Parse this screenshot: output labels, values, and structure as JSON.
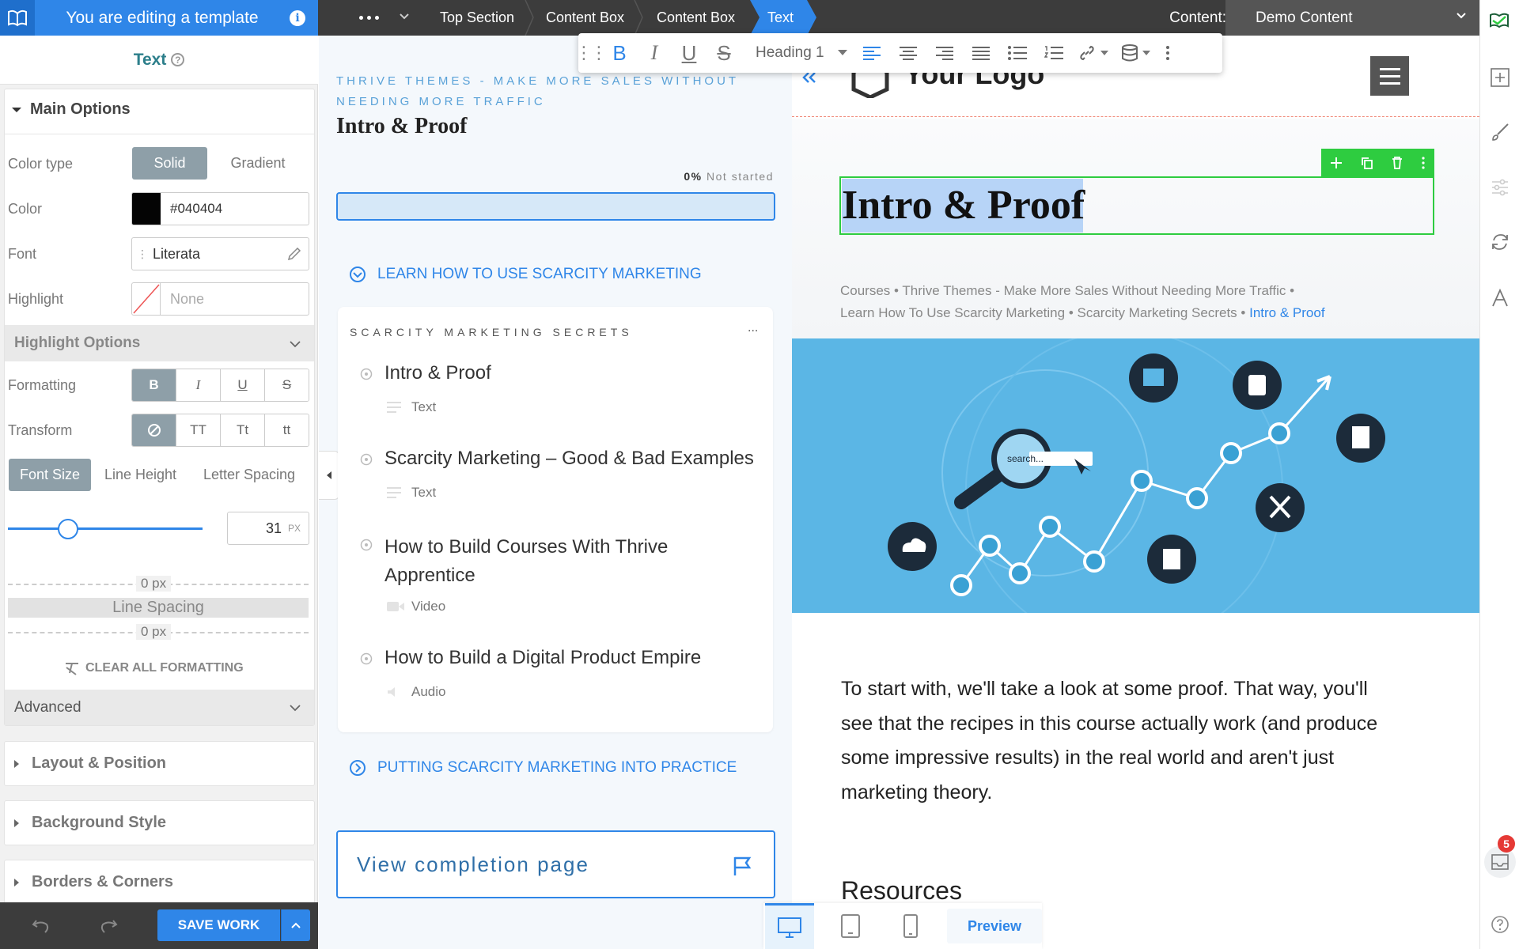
{
  "topbar": {
    "template_banner": "You are editing a template",
    "breadcrumbs": [
      "Top Section",
      "Content Box",
      "Content Box",
      "Text"
    ],
    "content_label": "Content:",
    "content_value": "Demo Content"
  },
  "left_panel": {
    "title": "Text",
    "main_options": "Main Options",
    "color_type_label": "Color type",
    "color_type_options": [
      "Solid",
      "Gradient"
    ],
    "color_label": "Color",
    "color_value": "#040404",
    "font_label": "Font",
    "font_value": "Literata",
    "highlight_label": "Highlight",
    "highlight_value": "None",
    "highlight_options": "Highlight Options",
    "formatting_label": "Formatting",
    "formatting_buttons": [
      "B",
      "I",
      "U",
      "S"
    ],
    "transform_label": "Transform",
    "transform_buttons": [
      "TT",
      "Tt",
      "tt"
    ],
    "size_tabs": [
      "Font Size",
      "Line Height",
      "Letter Spacing"
    ],
    "font_size": "31",
    "font_size_unit": "PX",
    "font_size_slider": 0.31,
    "spacing_top": "0 px",
    "line_spacing": "Line Spacing",
    "spacing_bottom": "0 px",
    "clear_formatting": "CLEAR ALL FORMATTING",
    "advanced": "Advanced",
    "sections": [
      "Layout & Position",
      "Background Style",
      "Borders & Corners"
    ],
    "save": "SAVE WORK"
  },
  "course": {
    "breadcrumb_line1": "THRIVE THEMES - MAKE MORE SALES WITHOUT",
    "breadcrumb_line2": "NEEDING MORE TRAFFIC",
    "lesson_title": "Intro & Proof",
    "progress_percent": "0%",
    "progress_status": "Not started",
    "progress_value": 0,
    "module1": "LEARN HOW TO USE SCARCITY MARKETING",
    "chapter": "SCARCITY MARKETING SECRETS",
    "chapter_more": "...",
    "lessons": [
      {
        "title": "Intro & Proof",
        "type": "Text"
      },
      {
        "title": "Scarcity Marketing – Good & Bad Examples",
        "type": "Text"
      },
      {
        "title_line1": "How to Build Courses With Thrive",
        "title_line2": "Apprentice",
        "type": "Video"
      },
      {
        "title": "How to Build a Digital Product Empire",
        "type": "Audio"
      }
    ],
    "module2": "PUTTING SCARCITY MARKETING INTO PRACTICE",
    "completion": "View completion page"
  },
  "toolbar": {
    "heading_select": "Heading 1"
  },
  "page": {
    "logo_text": "Your Logo",
    "heading": "Intro & Proof",
    "crumbs_line1": [
      "Courses",
      "Thrive Themes - Make More Sales Without Needing More Traffic"
    ],
    "crumbs_line2": [
      "Learn How To Use Scarcity Marketing",
      "Scarcity Marketing Secrets",
      "Intro & Proof"
    ],
    "search_text": "search...",
    "body_lines": [
      "To start with, we'll take a look at some proof. That way, you'll",
      "see that the recipes in this course actually work (and produce",
      "some impressive results) in the real world and aren't just",
      "marketing theory."
    ],
    "resources": "Resources",
    "hero_bg": "#5bb6e5",
    "accent": "#2f86e8",
    "select_green": "#2ecc40"
  },
  "bottom_bar": {
    "preview": "Preview"
  },
  "right_strip": {
    "notification_count": "5"
  }
}
